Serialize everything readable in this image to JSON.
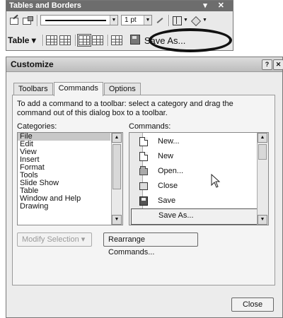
{
  "toolbar": {
    "title": "Tables and Borders",
    "title_controls": "▾ ✕",
    "line_weight": "1 pt",
    "table_menu_label": "Table",
    "table_menu_arrow": "▾",
    "saveas_label": "Save As..."
  },
  "dialog": {
    "title": "Customize",
    "help": "?",
    "close_x": "✕",
    "tabs": [
      "Toolbars",
      "Commands",
      "Options"
    ],
    "active_tab": "Commands",
    "instructions": "To add a command to a toolbar: select a category and drag the command out of this dialog box to a toolbar.",
    "categories_label": "Categories:",
    "commands_label": "Commands:",
    "categories": [
      "File",
      "Edit",
      "View",
      "Insert",
      "Format",
      "Tools",
      "Slide Show",
      "Table",
      "Window and Help",
      "Drawing"
    ],
    "selected_category": "File",
    "commands": [
      {
        "label": "New...",
        "icon": "new-document-icon"
      },
      {
        "label": "New",
        "icon": "new-document-icon"
      },
      {
        "label": "Open...",
        "icon": "open-folder-icon"
      },
      {
        "label": "Close",
        "icon": "close-document-icon"
      },
      {
        "label": "Save",
        "icon": "save-disk-icon"
      },
      {
        "label": "Save As...",
        "icon": ""
      }
    ],
    "selected_command": "Save As...",
    "modify_selection_label": "Modify Selection",
    "modify_selection_arrow": "▾",
    "rearrange_label": "Rearrange Commands...",
    "close_label": "Close",
    "scroll_up": "▲",
    "scroll_down": "▼"
  }
}
